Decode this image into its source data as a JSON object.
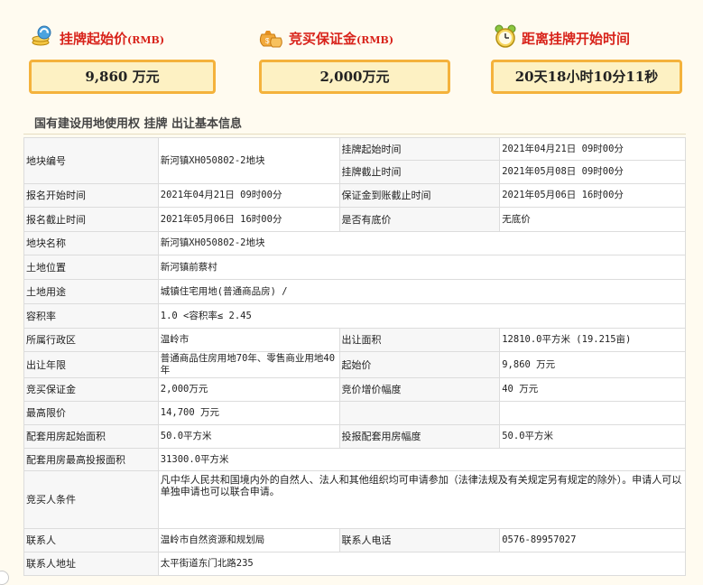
{
  "header": {
    "start_price": {
      "label": "挂牌起始价",
      "unit": "(RMB)",
      "value": "9,860 万元",
      "icon": "coins-refresh-icon"
    },
    "deposit": {
      "label": "竞买保证金",
      "unit": "(RMB)",
      "value": "2,000万元",
      "icon": "money-bags-icon"
    },
    "countdown": {
      "label": "距离挂牌开始时间",
      "value": "20天18小时10分11秒",
      "icon": "alarm-clock-icon"
    }
  },
  "section_title": "国有建设用地使用权 挂牌 出让基本信息",
  "table": {
    "parcel_no_label": "地块编号",
    "parcel_no": "新河镇XH050802-2地块",
    "listing_start_label": "挂牌起始时间",
    "listing_start": "2021年04月21日 09时00分",
    "listing_end_label": "挂牌截止时间",
    "listing_end": "2021年05月08日 09时00分",
    "reg_start_label": "报名开始时间",
    "reg_start": "2021年04月21日 09时00分",
    "deposit_deadline_label": "保证金到账截止时间",
    "deposit_deadline": "2021年05月06日 16时00分",
    "reg_end_label": "报名截止时间",
    "reg_end": "2021年05月06日 16时00分",
    "reserve_label": "是否有底价",
    "reserve": "无底价",
    "parcel_name_label": "地块名称",
    "parcel_name": "新河镇XH050802-2地块",
    "location_label": "土地位置",
    "location": "新河镇前蔡村",
    "use_label": "土地用途",
    "use": "城镇住宅用地(普通商品房) /",
    "far_label": "容积率",
    "far": "1.0 <容积率≤ 2.45",
    "district_label": "所属行政区",
    "district": "温岭市",
    "area_label": "出让面积",
    "area": "12810.0平方米 (19.215亩)",
    "term_label": "出让年限",
    "term": "普通商品住房用地70年、零售商业用地40年",
    "start_price_label": "起始价",
    "start_price": "9,860 万元",
    "bid_deposit_label": "竞买保证金",
    "bid_deposit": "2,000万元",
    "increment_label": "竞价增价幅度",
    "increment": "40 万元",
    "max_price_label": "最高限价",
    "max_price": "14,700 万元",
    "housing_start_label": "配套用房起始面积",
    "housing_start": "50.0平方米",
    "housing_increment_label": "投报配套用房幅度",
    "housing_increment": "50.0平方米",
    "housing_max_label": "配套用房最高投报面积",
    "housing_max": "31300.0平方米",
    "bidder_req_label": "竞买人条件",
    "bidder_req": "凡中华人民共和国境内外的自然人、法人和其他组织均可申请参加（法律法规及有关规定另有规定的除外）。申请人可以单独申请也可以联合申请。",
    "contact_label": "联系人",
    "contact": "温岭市自然资源和规划局",
    "phone_label": "联系人电话",
    "phone": "0576-89957027",
    "address_label": "联系人地址",
    "address": "太平街道东门北路235"
  }
}
